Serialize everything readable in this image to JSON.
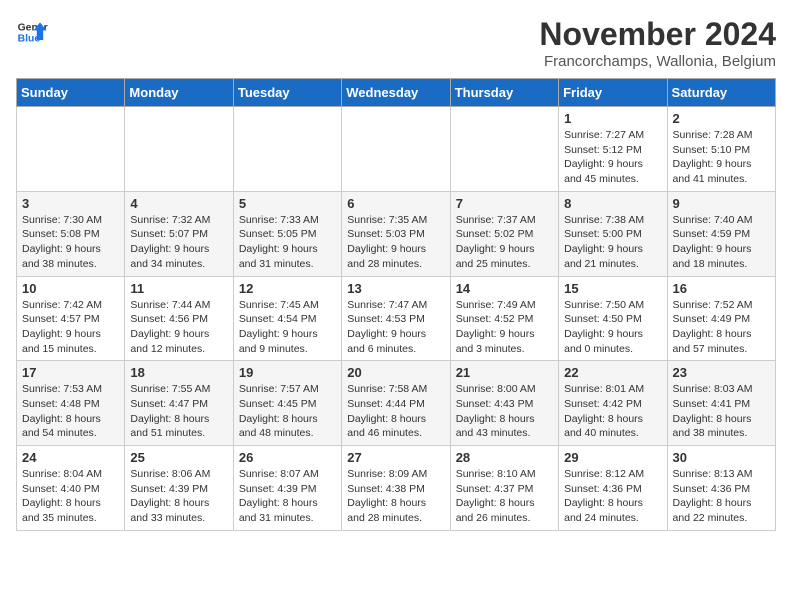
{
  "header": {
    "logo_general": "General",
    "logo_blue": "Blue",
    "month_title": "November 2024",
    "location": "Francorchamps, Wallonia, Belgium"
  },
  "days_of_week": [
    "Sunday",
    "Monday",
    "Tuesday",
    "Wednesday",
    "Thursday",
    "Friday",
    "Saturday"
  ],
  "weeks": [
    [
      {
        "day": "",
        "info": ""
      },
      {
        "day": "",
        "info": ""
      },
      {
        "day": "",
        "info": ""
      },
      {
        "day": "",
        "info": ""
      },
      {
        "day": "",
        "info": ""
      },
      {
        "day": "1",
        "info": "Sunrise: 7:27 AM\nSunset: 5:12 PM\nDaylight: 9 hours\nand 45 minutes."
      },
      {
        "day": "2",
        "info": "Sunrise: 7:28 AM\nSunset: 5:10 PM\nDaylight: 9 hours\nand 41 minutes."
      }
    ],
    [
      {
        "day": "3",
        "info": "Sunrise: 7:30 AM\nSunset: 5:08 PM\nDaylight: 9 hours\nand 38 minutes."
      },
      {
        "day": "4",
        "info": "Sunrise: 7:32 AM\nSunset: 5:07 PM\nDaylight: 9 hours\nand 34 minutes."
      },
      {
        "day": "5",
        "info": "Sunrise: 7:33 AM\nSunset: 5:05 PM\nDaylight: 9 hours\nand 31 minutes."
      },
      {
        "day": "6",
        "info": "Sunrise: 7:35 AM\nSunset: 5:03 PM\nDaylight: 9 hours\nand 28 minutes."
      },
      {
        "day": "7",
        "info": "Sunrise: 7:37 AM\nSunset: 5:02 PM\nDaylight: 9 hours\nand 25 minutes."
      },
      {
        "day": "8",
        "info": "Sunrise: 7:38 AM\nSunset: 5:00 PM\nDaylight: 9 hours\nand 21 minutes."
      },
      {
        "day": "9",
        "info": "Sunrise: 7:40 AM\nSunset: 4:59 PM\nDaylight: 9 hours\nand 18 minutes."
      }
    ],
    [
      {
        "day": "10",
        "info": "Sunrise: 7:42 AM\nSunset: 4:57 PM\nDaylight: 9 hours\nand 15 minutes."
      },
      {
        "day": "11",
        "info": "Sunrise: 7:44 AM\nSunset: 4:56 PM\nDaylight: 9 hours\nand 12 minutes."
      },
      {
        "day": "12",
        "info": "Sunrise: 7:45 AM\nSunset: 4:54 PM\nDaylight: 9 hours\nand 9 minutes."
      },
      {
        "day": "13",
        "info": "Sunrise: 7:47 AM\nSunset: 4:53 PM\nDaylight: 9 hours\nand 6 minutes."
      },
      {
        "day": "14",
        "info": "Sunrise: 7:49 AM\nSunset: 4:52 PM\nDaylight: 9 hours\nand 3 minutes."
      },
      {
        "day": "15",
        "info": "Sunrise: 7:50 AM\nSunset: 4:50 PM\nDaylight: 9 hours\nand 0 minutes."
      },
      {
        "day": "16",
        "info": "Sunrise: 7:52 AM\nSunset: 4:49 PM\nDaylight: 8 hours\nand 57 minutes."
      }
    ],
    [
      {
        "day": "17",
        "info": "Sunrise: 7:53 AM\nSunset: 4:48 PM\nDaylight: 8 hours\nand 54 minutes."
      },
      {
        "day": "18",
        "info": "Sunrise: 7:55 AM\nSunset: 4:47 PM\nDaylight: 8 hours\nand 51 minutes."
      },
      {
        "day": "19",
        "info": "Sunrise: 7:57 AM\nSunset: 4:45 PM\nDaylight: 8 hours\nand 48 minutes."
      },
      {
        "day": "20",
        "info": "Sunrise: 7:58 AM\nSunset: 4:44 PM\nDaylight: 8 hours\nand 46 minutes."
      },
      {
        "day": "21",
        "info": "Sunrise: 8:00 AM\nSunset: 4:43 PM\nDaylight: 8 hours\nand 43 minutes."
      },
      {
        "day": "22",
        "info": "Sunrise: 8:01 AM\nSunset: 4:42 PM\nDaylight: 8 hours\nand 40 minutes."
      },
      {
        "day": "23",
        "info": "Sunrise: 8:03 AM\nSunset: 4:41 PM\nDaylight: 8 hours\nand 38 minutes."
      }
    ],
    [
      {
        "day": "24",
        "info": "Sunrise: 8:04 AM\nSunset: 4:40 PM\nDaylight: 8 hours\nand 35 minutes."
      },
      {
        "day": "25",
        "info": "Sunrise: 8:06 AM\nSunset: 4:39 PM\nDaylight: 8 hours\nand 33 minutes."
      },
      {
        "day": "26",
        "info": "Sunrise: 8:07 AM\nSunset: 4:39 PM\nDaylight: 8 hours\nand 31 minutes."
      },
      {
        "day": "27",
        "info": "Sunrise: 8:09 AM\nSunset: 4:38 PM\nDaylight: 8 hours\nand 28 minutes."
      },
      {
        "day": "28",
        "info": "Sunrise: 8:10 AM\nSunset: 4:37 PM\nDaylight: 8 hours\nand 26 minutes."
      },
      {
        "day": "29",
        "info": "Sunrise: 8:12 AM\nSunset: 4:36 PM\nDaylight: 8 hours\nand 24 minutes."
      },
      {
        "day": "30",
        "info": "Sunrise: 8:13 AM\nSunset: 4:36 PM\nDaylight: 8 hours\nand 22 minutes."
      }
    ]
  ]
}
